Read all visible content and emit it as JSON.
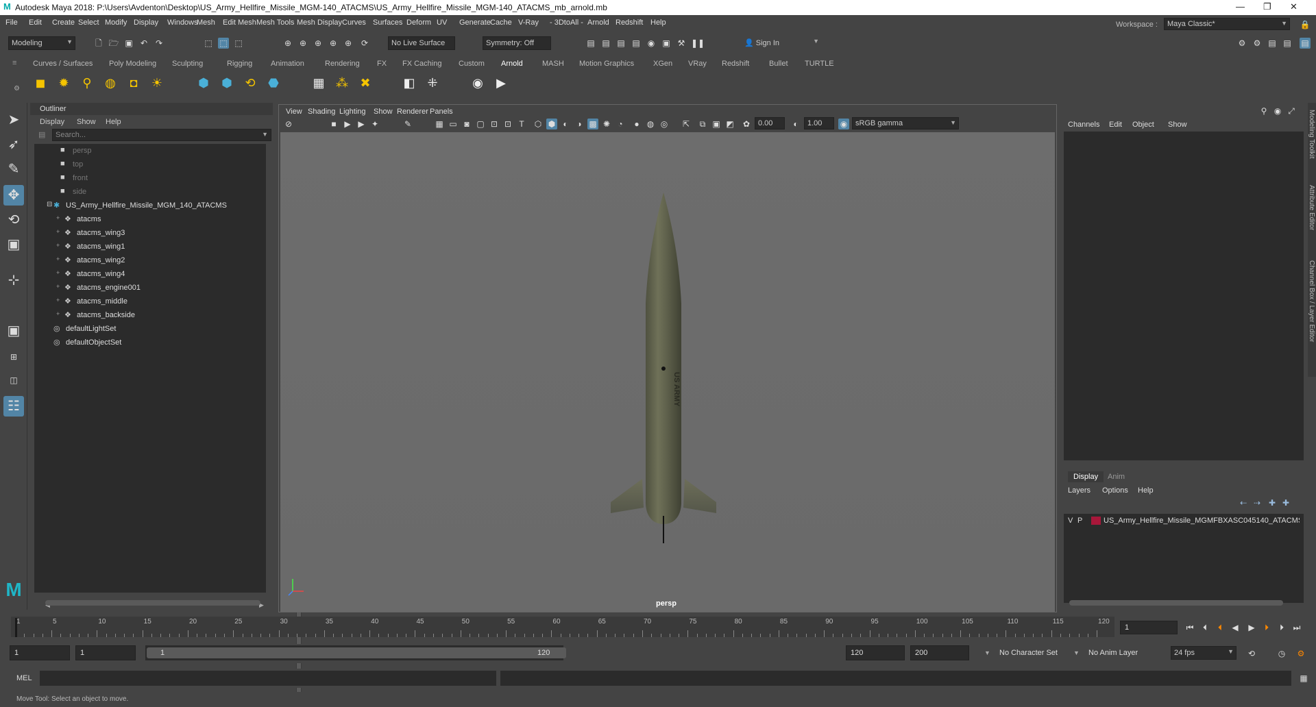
{
  "app": {
    "title": "Autodesk Maya 2018: P:\\Users\\Avdenton\\Desktop\\US_Army_Hellfire_Missile_MGM-140_ATACMS\\US_Army_Hellfire_Missile_MGM-140_ATACMS_mb_arnold.mb"
  },
  "menubar": [
    "File",
    "Edit",
    "Create",
    "Select",
    "Modify",
    "Display",
    "Windows",
    "Mesh",
    "Edit Mesh",
    "Mesh Tools",
    "Mesh Display",
    "Curves",
    "Surfaces",
    "Deform",
    "UV",
    "Generate",
    "Cache",
    "V-Ray",
    "- 3DtoAll -",
    "Arnold",
    "Redshift",
    "Help"
  ],
  "workspace": {
    "label": "Workspace :",
    "value": "Maya Classic*"
  },
  "status": {
    "mode": "Modeling",
    "live_surface": "No Live Surface",
    "symmetry": "Symmetry: Off",
    "sign_in": "Sign In"
  },
  "shelf_tabs": [
    "Curves / Surfaces",
    "Poly Modeling",
    "Sculpting",
    "Rigging",
    "Animation",
    "Rendering",
    "FX",
    "FX Caching",
    "Custom",
    "Arnold",
    "MASH",
    "Motion Graphics",
    "XGen",
    "VRay",
    "Redshift",
    "Bullet",
    "TURTLE"
  ],
  "shelf_active": "Arnold",
  "outliner": {
    "title": "Outliner",
    "menus": [
      "Display",
      "Show",
      "Help"
    ],
    "search_placeholder": "Search...",
    "items": [
      {
        "label": "persp",
        "type": "camera",
        "dim": true
      },
      {
        "label": "top",
        "type": "camera",
        "dim": true
      },
      {
        "label": "front",
        "type": "camera",
        "dim": true
      },
      {
        "label": "side",
        "type": "camera",
        "dim": true
      },
      {
        "label": "US_Army_Hellfire_Missile_MGM_140_ATACMS",
        "type": "group",
        "dim": false
      },
      {
        "label": "atacms",
        "type": "mesh",
        "dim": false
      },
      {
        "label": "atacms_wing3",
        "type": "mesh",
        "dim": false
      },
      {
        "label": "atacms_wing1",
        "type": "mesh",
        "dim": false
      },
      {
        "label": "atacms_wing2",
        "type": "mesh",
        "dim": false
      },
      {
        "label": "atacms_wing4",
        "type": "mesh",
        "dim": false
      },
      {
        "label": "atacms_engine001",
        "type": "mesh",
        "dim": false
      },
      {
        "label": "atacms_middle",
        "type": "mesh",
        "dim": false
      },
      {
        "label": "atacms_backside",
        "type": "mesh",
        "dim": false
      },
      {
        "label": "defaultLightSet",
        "type": "set",
        "dim": false
      },
      {
        "label": "defaultObjectSet",
        "type": "set",
        "dim": false
      }
    ]
  },
  "viewport": {
    "menus": [
      "View",
      "Shading",
      "Lighting",
      "Show",
      "Renderer",
      "Panels"
    ],
    "exposure": "0.00",
    "gamma": "1.00",
    "colorspace": "sRGB gamma",
    "camera": "persp"
  },
  "channelbox": {
    "menus": [
      "Channels",
      "Edit",
      "Object",
      "Show"
    ]
  },
  "layers": {
    "tabs": [
      "Display",
      "Anim"
    ],
    "menus": [
      "Layers",
      "Options",
      "Help"
    ],
    "layer": {
      "v": "V",
      "p": "P",
      "name": "US_Army_Hellfire_Missile_MGMFBXASC045140_ATACMS",
      "color": "#a8173a"
    }
  },
  "side_tabs": [
    "Modeling Toolkit",
    "Attribute Editor",
    "Channel Box / Layer Editor"
  ],
  "timeline": {
    "ticks": [
      1,
      5,
      10,
      15,
      20,
      25,
      30,
      35,
      40,
      45,
      50,
      55,
      60,
      65,
      70,
      75,
      80,
      85,
      90,
      95,
      100,
      105,
      110,
      115,
      120
    ],
    "current": "1"
  },
  "range": {
    "start": "1",
    "playback_start": "1",
    "slider_start": "1",
    "slider_end": "120",
    "playback_end": "120",
    "end": "200",
    "character_set": "No Character Set",
    "anim_layer": "No Anim Layer",
    "fps": "24 fps"
  },
  "cmd": {
    "label": "MEL"
  },
  "help": {
    "text": "Move Tool: Select an object to move."
  }
}
